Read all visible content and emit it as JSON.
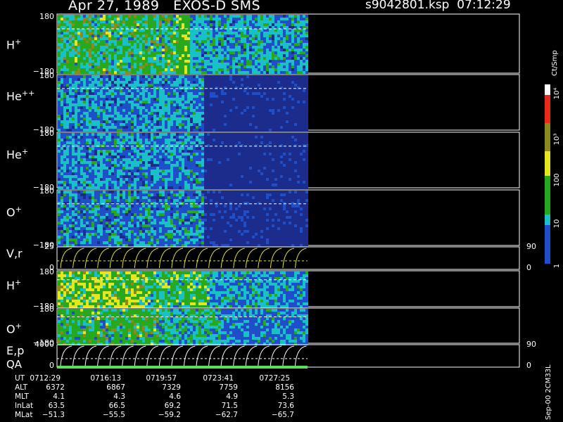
{
  "header": {
    "date": "Apr 27, 1989",
    "instrument": "EXOS-D SMS",
    "file": "s9042801.ksp",
    "start_time": "07:12:29"
  },
  "colors": {
    "high": "#ffffff",
    "red": "#e82a18",
    "olive": "#8a8a1e",
    "yellow": "#e6e61e",
    "green": "#28a81e",
    "cyan": "#19c0c8",
    "blue": "#1e4ec8",
    "navy": "#1c2c8c",
    "background": "#000000"
  },
  "chart_data": [
    {
      "type": "heatmap",
      "panel": "H+",
      "label_base": "H",
      "label_sup": "+",
      "ylim": [
        -180,
        180
      ],
      "ytick_labels": [
        "180",
        "−180"
      ],
      "dashed_reference": 90
    },
    {
      "type": "heatmap",
      "panel": "He++",
      "label_base": "He",
      "label_sup": "++",
      "ylim": [
        -180,
        180
      ],
      "ytick_labels": [
        "180",
        "−180"
      ],
      "dashed_reference": 90
    },
    {
      "type": "heatmap",
      "panel": "He+",
      "label_base": "He",
      "label_sup": "+",
      "ylim": [
        -180,
        180
      ],
      "ytick_labels": [
        "180",
        "−180"
      ],
      "dashed_reference": 90
    },
    {
      "type": "heatmap",
      "panel": "O+",
      "label_base": "O",
      "label_sup": "+",
      "ylim": [
        -180,
        180
      ],
      "ytick_labels": [
        "180",
        "−180"
      ],
      "dashed_reference": 90
    },
    {
      "type": "line",
      "panel": "V,r",
      "label_base": "V,r",
      "label_sup": "",
      "ylim": [
        0,
        25
      ],
      "ytick_labels": [
        "25",
        "0"
      ],
      "right_ytick_labels": [
        "90",
        "0"
      ]
    },
    {
      "type": "heatmap",
      "panel": "H+ (lower)",
      "label_base": "H",
      "label_sup": "+",
      "ylim": [
        -180,
        180
      ],
      "ytick_labels": [
        "180",
        "−180"
      ],
      "dashed_reference": 90
    },
    {
      "type": "heatmap",
      "panel": "O+ (lower)",
      "label_base": "O",
      "label_sup": "+",
      "ylim": [
        -180,
        180
      ],
      "ytick_labels": [
        "180",
        "−180"
      ],
      "dashed_reference": 90
    },
    {
      "type": "line",
      "panel": "E,p",
      "label_base": "E,p",
      "label_sup": "",
      "ylim": [
        0,
        4000
      ],
      "ytick_labels": [
        "4000",
        "0"
      ],
      "right_ytick_labels": [
        "90",
        "0"
      ]
    }
  ],
  "qa_label": "QA",
  "colorbar": {
    "unit": "Ct/Smp",
    "scale": "log",
    "range": [
      1,
      10000
    ],
    "tick_labels": [
      "10⁴",
      "10³",
      "100",
      "10",
      "1"
    ]
  },
  "info_table": {
    "rows": [
      {
        "label": "UT",
        "values": [
          "0712:29",
          "0716:13",
          "0719:57",
          "0723:41",
          "0727:25"
        ]
      },
      {
        "label": "ALT",
        "values": [
          "6372",
          "6867",
          "7329",
          "7759",
          "8156"
        ]
      },
      {
        "label": "MLT",
        "values": [
          "4.1",
          "4.3",
          "4.6",
          "4.9",
          "5.3"
        ]
      },
      {
        "label": "InLat",
        "values": [
          "63.5",
          "66.5",
          "69.2",
          "71.5",
          "73.6"
        ]
      },
      {
        "label": "MLat",
        "values": [
          "−51.3",
          "−55.5",
          "−59.2",
          "−62.7",
          "−65.7"
        ]
      }
    ]
  },
  "footnote": "Sep-00 2CM33L"
}
